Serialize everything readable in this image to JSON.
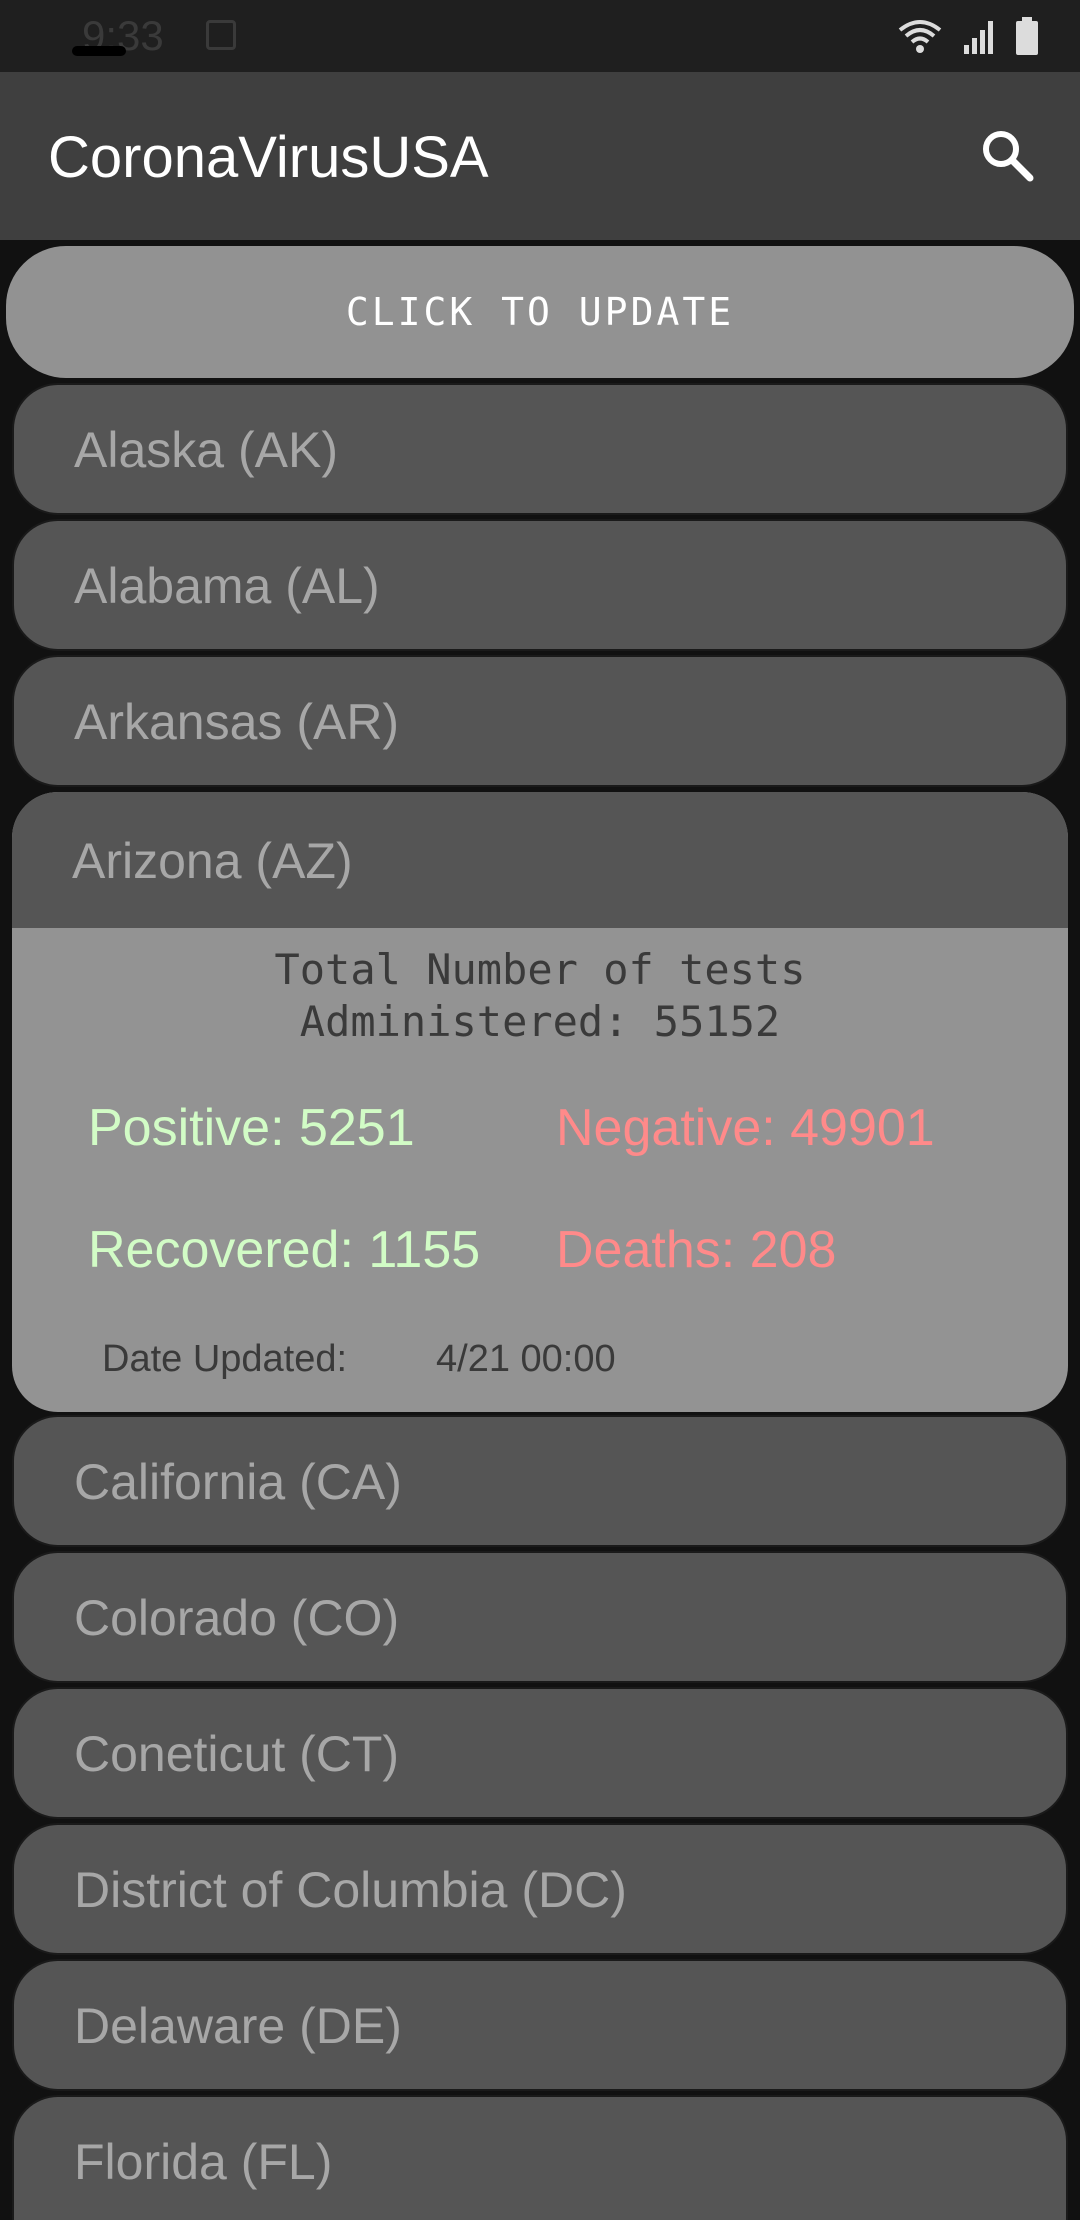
{
  "status_bar": {
    "time": "9:33"
  },
  "app_bar": {
    "title": "CoronaVirusUSA"
  },
  "update_button": {
    "label": "CLICK TO UPDATE"
  },
  "states_before": [
    {
      "label": "Alaska (AK)"
    },
    {
      "label": "Alabama (AL)"
    },
    {
      "label": "Arkansas (AR)"
    }
  ],
  "expanded_state": {
    "label": "Arizona (AZ)",
    "tests_line1": "Total Number of tests",
    "tests_line2": "Administered: 55152",
    "positive": "Positive: 5251",
    "negative": "Negative: 49901",
    "recovered": "Recovered: 1155",
    "deaths": "Deaths: 208",
    "date_label": "Date Updated:",
    "date_value": "4/21 00:00"
  },
  "states_after": [
    {
      "label": "California (CA)"
    },
    {
      "label": "Colorado (CO)"
    },
    {
      "label": "Coneticut (CT)"
    },
    {
      "label": "District of Columbia (DC)"
    },
    {
      "label": "Delaware (DE)"
    },
    {
      "label": "Florida (FL)"
    }
  ],
  "colors": {
    "positive": "#d2fcc6",
    "negative": "#ff8a8a",
    "item_bg": "#555555",
    "expanded_bg": "#939393"
  }
}
